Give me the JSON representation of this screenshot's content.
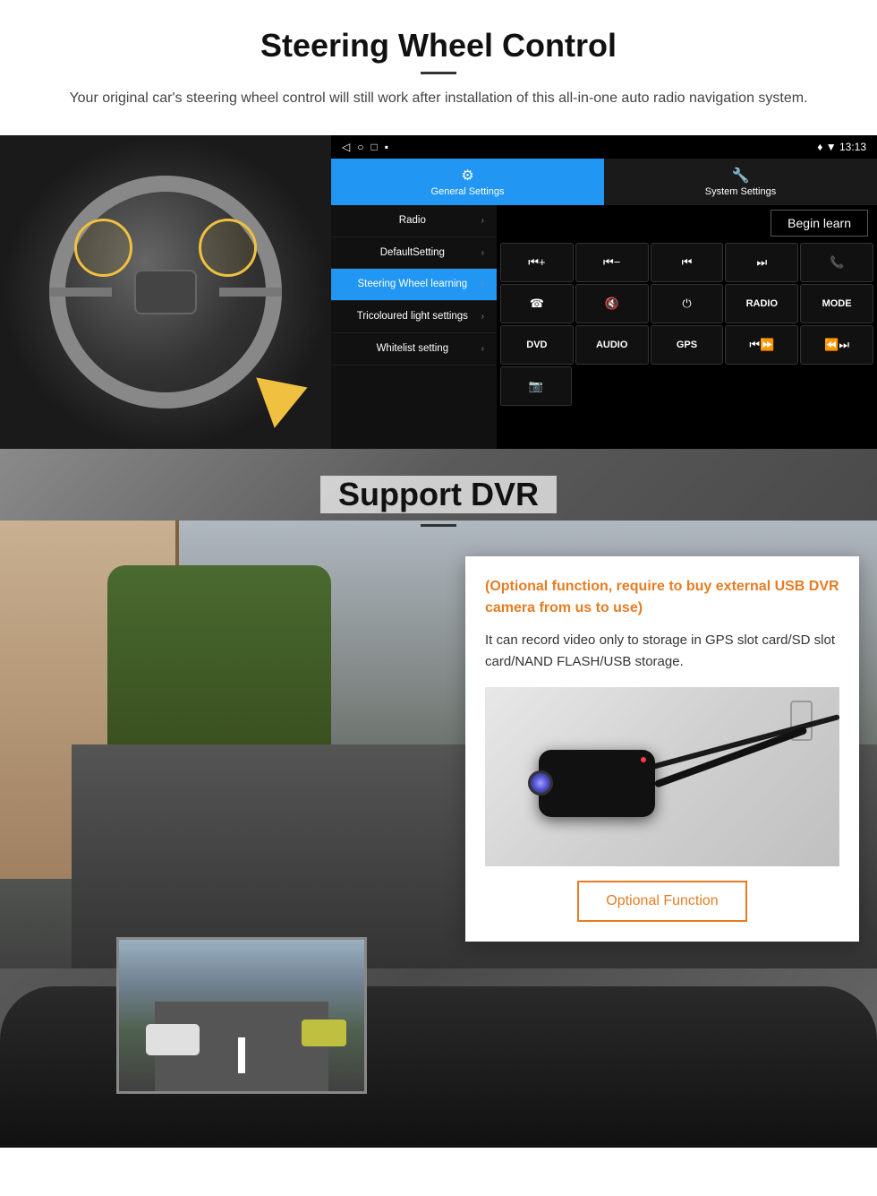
{
  "page": {
    "section1": {
      "title": "Steering Wheel Control",
      "description": "Your original car's steering wheel control will still work after installation of this all-in-one auto radio navigation system.",
      "statusbar": {
        "icons": [
          "◁",
          "○",
          "□",
          "▪"
        ],
        "time": "13:13",
        "signal": "▼"
      },
      "tabs": [
        {
          "label": "General Settings",
          "icon": "⚙",
          "active": true
        },
        {
          "label": "System Settings",
          "icon": "🔧",
          "active": false
        }
      ],
      "menu_items": [
        {
          "label": "Radio",
          "active": false
        },
        {
          "label": "DefaultSetting",
          "active": false
        },
        {
          "label": "Steering Wheel learning",
          "active": true
        },
        {
          "label": "Tricoloured light settings",
          "active": false
        },
        {
          "label": "Whitelist setting",
          "active": false
        }
      ],
      "begin_learn_label": "Begin learn",
      "control_buttons": [
        [
          {
            "label": "⏮+",
            "type": "icon"
          },
          {
            "label": "⏮-",
            "type": "icon"
          },
          {
            "label": "⏮",
            "type": "icon"
          },
          {
            "label": "⏭",
            "type": "icon"
          },
          {
            "label": "📞",
            "type": "icon"
          }
        ],
        [
          {
            "label": "☎",
            "type": "icon"
          },
          {
            "label": "🔇",
            "type": "icon"
          },
          {
            "label": "⏻",
            "type": "icon"
          },
          {
            "label": "RADIO",
            "type": "text"
          },
          {
            "label": "MODE",
            "type": "text"
          }
        ],
        [
          {
            "label": "DVD",
            "type": "text"
          },
          {
            "label": "AUDIO",
            "type": "text"
          },
          {
            "label": "GPS",
            "type": "text"
          },
          {
            "label": "⏮⏩",
            "type": "icon"
          },
          {
            "label": "⏪⏭",
            "type": "icon"
          }
        ],
        [
          {
            "label": "📷",
            "type": "icon"
          }
        ]
      ]
    },
    "section2": {
      "title": "Support DVR",
      "optional_text": "(Optional function, require to buy external USB DVR camera from us to use)",
      "body_text": "It can record video only to storage in GPS slot card/SD slot card/NAND FLASH/USB storage.",
      "optional_function_label": "Optional Function"
    }
  }
}
